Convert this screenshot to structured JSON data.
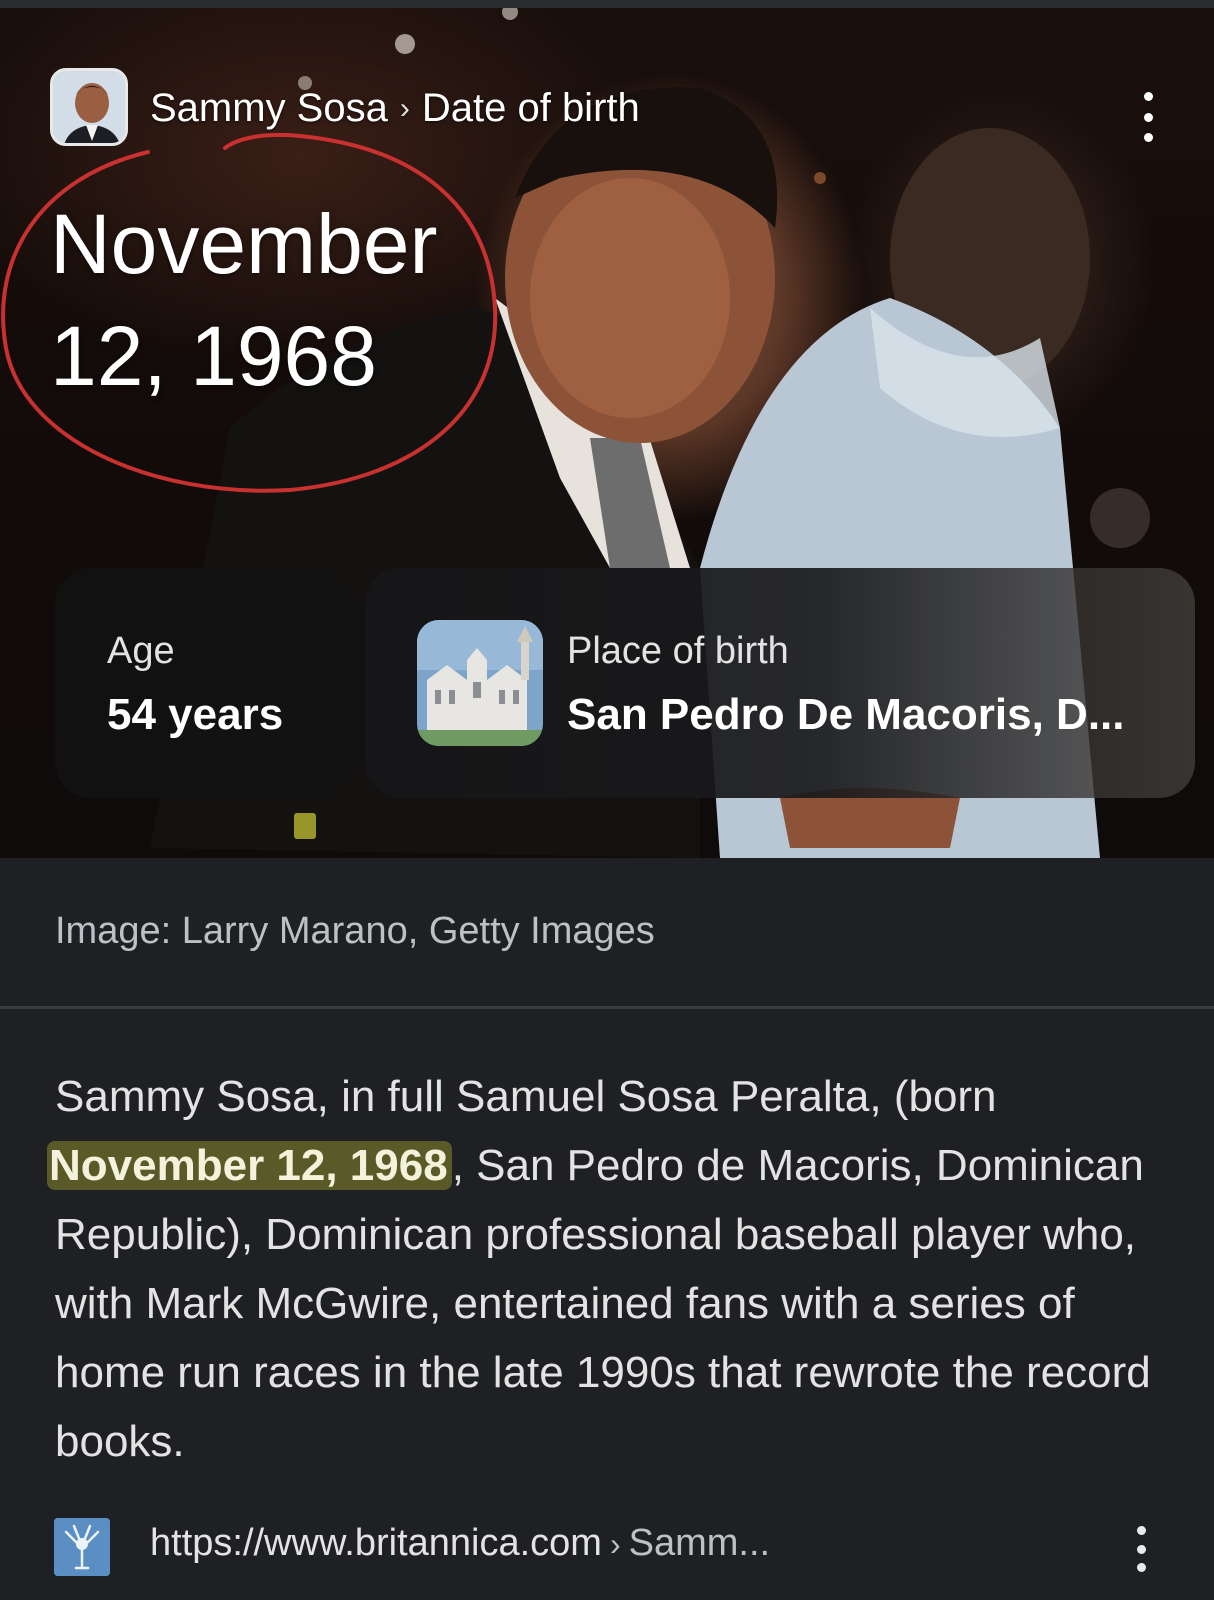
{
  "breadcrumb": {
    "entity": "Sammy Sosa",
    "separator": "›",
    "attribute": "Date of birth"
  },
  "answer": {
    "date_line1": "November",
    "date_line2": "12, 1968"
  },
  "cards": {
    "age": {
      "label": "Age",
      "value": "54 years"
    },
    "place": {
      "label": "Place of birth",
      "value": "San Pedro De Macoris, D..."
    }
  },
  "image_credit": "Image: Larry Marano, Getty Images",
  "description": {
    "before": "Sammy Sosa, in full Samuel Sosa Peralta, (born ",
    "highlight": "November 12, 1968",
    "after": ", San Pedro de Macoris, Dominican Republic), Dominican professional baseball player who, with Mark McGwire, entertained fans with a series of home run races in the late 1990s that rewrote the record books."
  },
  "source": {
    "url": "https://www.britannica.com",
    "separator": "›",
    "crumb": "Samm..."
  },
  "icons": {
    "top_menu": "more-vert-icon",
    "source_menu": "more-vert-icon",
    "source_logo": "britannica-thistle-icon"
  },
  "colors": {
    "background": "#1f2023",
    "highlight": "#5a5a28",
    "annotation": "#c8312f"
  }
}
